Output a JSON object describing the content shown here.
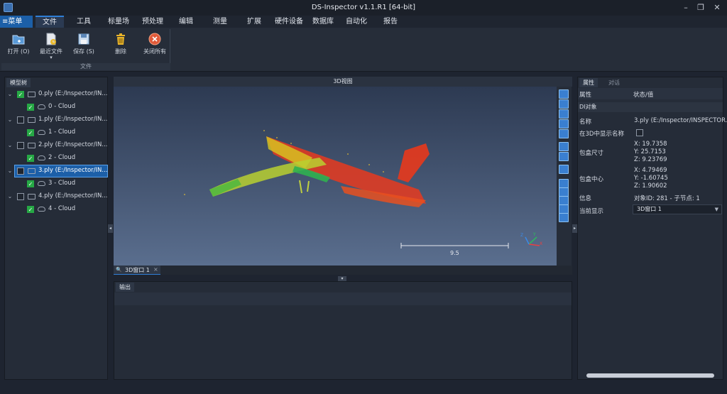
{
  "window": {
    "title": "DS-Inspector v1.1.R1 [64-bit]"
  },
  "menubar": {
    "menu_button": "≡菜单",
    "items": [
      "文件",
      "工具",
      "标量场",
      "预处理",
      "编辑",
      "测量",
      "扩展",
      "硬件设备",
      "数据库",
      "自动化",
      "报告"
    ]
  },
  "ribbon": {
    "buttons": [
      "打开 (O)",
      "最近文件",
      "保存 (S)",
      "删除",
      "关闭所有"
    ],
    "group_title": "文件"
  },
  "model_tree": {
    "tab": "模型树",
    "items": [
      {
        "file": "0.ply (E:/Inspector/IN...",
        "cloud": "0 - Cloud"
      },
      {
        "file": "1.ply (E:/Inspector/IN...",
        "cloud": "1 - Cloud"
      },
      {
        "file": "2.ply (E:/Inspector/IN...",
        "cloud": "2 - Cloud"
      },
      {
        "file": "3.ply (E:/Inspector/IN...",
        "cloud": "3 - Cloud"
      },
      {
        "file": "4.ply (E:/Inspector/IN...",
        "cloud": "4 - Cloud"
      }
    ]
  },
  "view3d": {
    "title": "3D视图",
    "scale_value": "9.5",
    "tab": "3D窗口 1",
    "axis_x": "X",
    "axis_y": "Y",
    "axis_z": "Z"
  },
  "output": {
    "tab": "输出"
  },
  "properties": {
    "tabs": [
      "属性",
      "对话"
    ],
    "col_prop": "属性",
    "col_value": "状态/值",
    "section": "DI对象",
    "name_key": "名称",
    "name_val": "3.ply (E:/Inspector/INSPECTOR...",
    "show3d_key": "在3D中显示名称",
    "bbox_key": "包盒尺寸",
    "bbox_x": "X: 19.7358",
    "bbox_y": "Y: 25.7153",
    "bbox_z": "Z: 9.23769",
    "center_key": "包盒中心",
    "center_x": "X: 4.79469",
    "center_y": "Y: -1.60745",
    "center_z": "Z: 1.90602",
    "info_key": "信息",
    "info_val": "对象ID: 281 - 子节点: 1",
    "display_key": "当前显示",
    "display_val": "3D窗口 1"
  },
  "colors": {
    "accent": "#1c5fa8",
    "check": "#26a845",
    "cloud_red": "#e8321e",
    "cloud_yellow": "#d8d020",
    "cloud_green": "#38b040"
  }
}
